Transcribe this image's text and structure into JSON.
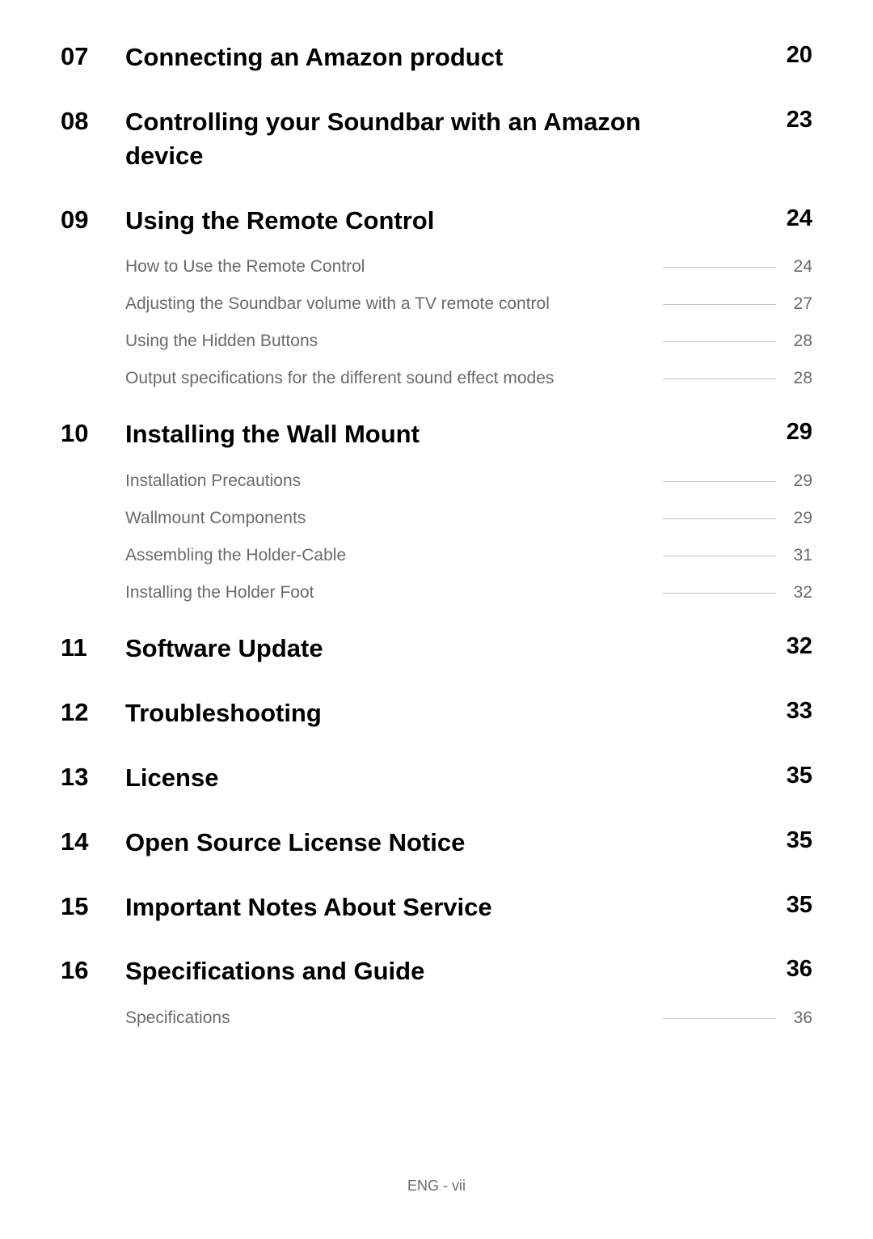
{
  "chapters": [
    {
      "num": "07",
      "title": "Connecting an Amazon product",
      "page": "20",
      "subs": []
    },
    {
      "num": "08",
      "title": "Controlling your Soundbar with an Amazon device",
      "page": "23",
      "subs": []
    },
    {
      "num": "09",
      "title": "Using the Remote Control",
      "page": "24",
      "subs": [
        {
          "title": "How to Use the Remote Control",
          "page": "24"
        },
        {
          "title": "Adjusting the Soundbar volume with a TV remote control",
          "page": "27"
        },
        {
          "title": "Using the Hidden Buttons",
          "page": "28"
        },
        {
          "title": "Output specifications for the different sound effect modes",
          "page": "28"
        }
      ]
    },
    {
      "num": "10",
      "title": "Installing the Wall Mount",
      "page": "29",
      "subs": [
        {
          "title": "Installation Precautions",
          "page": "29"
        },
        {
          "title": "Wallmount Components",
          "page": "29"
        },
        {
          "title": "Assembling the Holder-Cable",
          "page": "31"
        },
        {
          "title": "Installing the Holder Foot",
          "page": "32"
        }
      ]
    },
    {
      "num": "11",
      "title": "Software Update",
      "page": "32",
      "subs": []
    },
    {
      "num": "12",
      "title": "Troubleshooting",
      "page": "33",
      "subs": []
    },
    {
      "num": "13",
      "title": "License",
      "page": "35",
      "subs": []
    },
    {
      "num": "14",
      "title": "Open Source License Notice",
      "page": "35",
      "subs": []
    },
    {
      "num": "15",
      "title": "Important Notes About Service",
      "page": "35",
      "subs": []
    },
    {
      "num": "16",
      "title": "Specifications and Guide",
      "page": "36",
      "subs": [
        {
          "title": "Specifications",
          "page": "36"
        }
      ]
    }
  ],
  "footer": "ENG - vii"
}
